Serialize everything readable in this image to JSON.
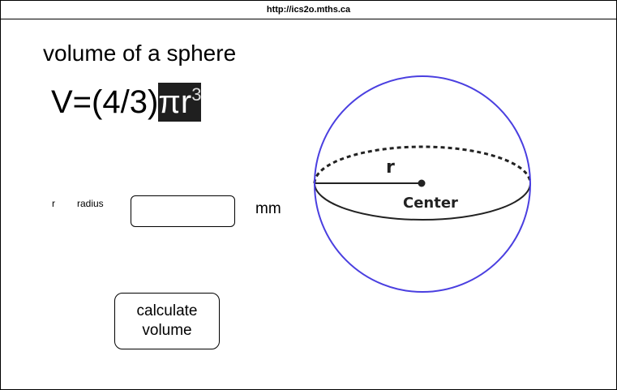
{
  "browser": {
    "url": "http://ics2o.mths.ca"
  },
  "page": {
    "title": "volume of a sphere",
    "formula": {
      "main": "V=(4/3)",
      "pi_r": "πr",
      "exponent": "3"
    }
  },
  "form": {
    "radius_symbol": "r",
    "radius_label": "radius",
    "radius_value": "",
    "radius_placeholder": "",
    "unit": "mm",
    "calculate_button_label": "calculate volume"
  },
  "diagram": {
    "radius_label": "r",
    "center_label": "Center",
    "outline_color": "#4a3fe0",
    "line_color": "#222222"
  }
}
